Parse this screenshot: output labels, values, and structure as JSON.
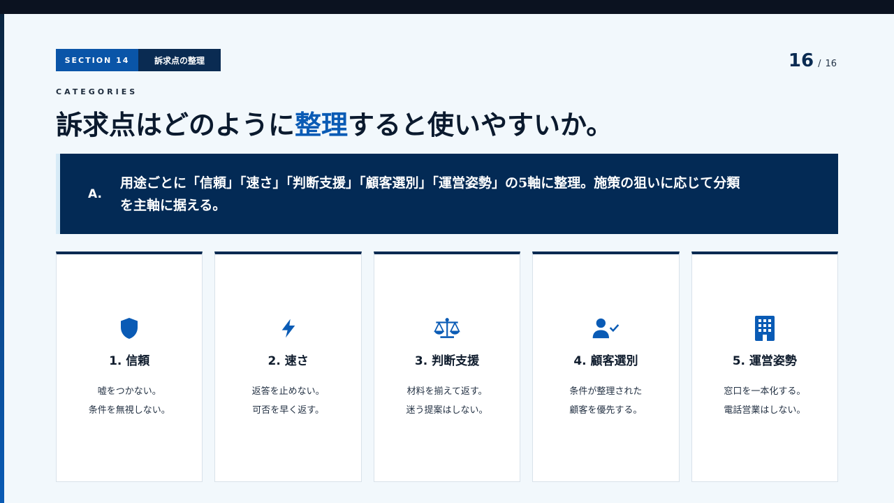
{
  "section": {
    "number_label": "SECTION 14",
    "name": "訴求点の整理"
  },
  "page": {
    "current": "16",
    "separator": "/",
    "total": "16"
  },
  "eyebrow": "CATEGORIES",
  "headline": {
    "before": "訴求点はどのように",
    "accent": "整理",
    "after": "すると使いやすいか。"
  },
  "answer": {
    "label": "A.",
    "line1": "用途ごとに「信頼」「速さ」「判断支援」「顧客選別」「運営姿勢」の5軸に整理。施策の狙いに応じて分類",
    "line2": "を主軸に据える。"
  },
  "cards": [
    {
      "icon": "shield-icon",
      "title": "1. 信頼",
      "line1": "嘘をつかない。",
      "line2": "条件を無視しない。"
    },
    {
      "icon": "lightning-icon",
      "title": "2. 速さ",
      "line1": "返答を止めない。",
      "line2": "可否を早く返す。"
    },
    {
      "icon": "scale-icon",
      "title": "3. 判断支援",
      "line1": "材料を揃えて返す。",
      "line2": "迷う提案はしない。"
    },
    {
      "icon": "user-check-icon",
      "title": "4. 顧客選別",
      "line1": "条件が整理された",
      "line2": "顧客を優先する。"
    },
    {
      "icon": "building-icon",
      "title": "5. 運営姿勢",
      "line1": "窓口を一本化する。",
      "line2": "電話営業はしない。"
    }
  ],
  "colors": {
    "accent": "#0a5bb5",
    "navy": "#032a55",
    "background": "#f2f8fc"
  }
}
